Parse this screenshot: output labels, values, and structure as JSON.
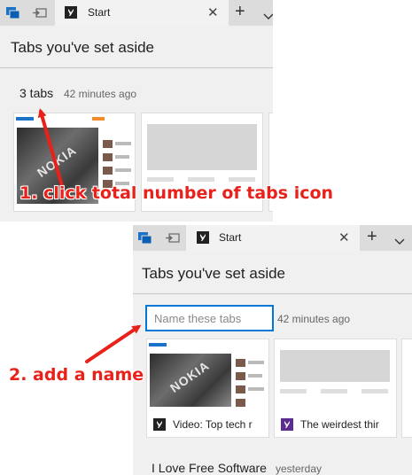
{
  "screen1": {
    "tab_title": "Start",
    "heading": "Tabs you've set aside",
    "tab_count": "3 tabs",
    "time": "42 minutes ago"
  },
  "screen2": {
    "tab_title": "Start",
    "heading": "Tabs you've set aside",
    "name_placeholder": "Name these tabs",
    "time": "42 minutes ago",
    "thumbnails": [
      {
        "caption": "Video: Top tech r"
      },
      {
        "caption": "The weirdest thir"
      }
    ],
    "next_group": {
      "title": "I Love Free Software",
      "time": "yesterday"
    }
  },
  "annotations": {
    "step1": "1. click total number of tabs icon",
    "step2": "2. add a name"
  },
  "colors": {
    "accent": "#0078d7",
    "annotation": "#e8221b",
    "panel": "#f0f0f0",
    "tabbar": "#dcdcdc"
  },
  "icons": [
    "set-aside-tabs-icon",
    "restore-tabs-icon",
    "start-tab-favicon",
    "close-icon",
    "new-tab-plus-icon",
    "tab-preview-chevron-icon",
    "video-favicon",
    "weirdest-favicon"
  ]
}
